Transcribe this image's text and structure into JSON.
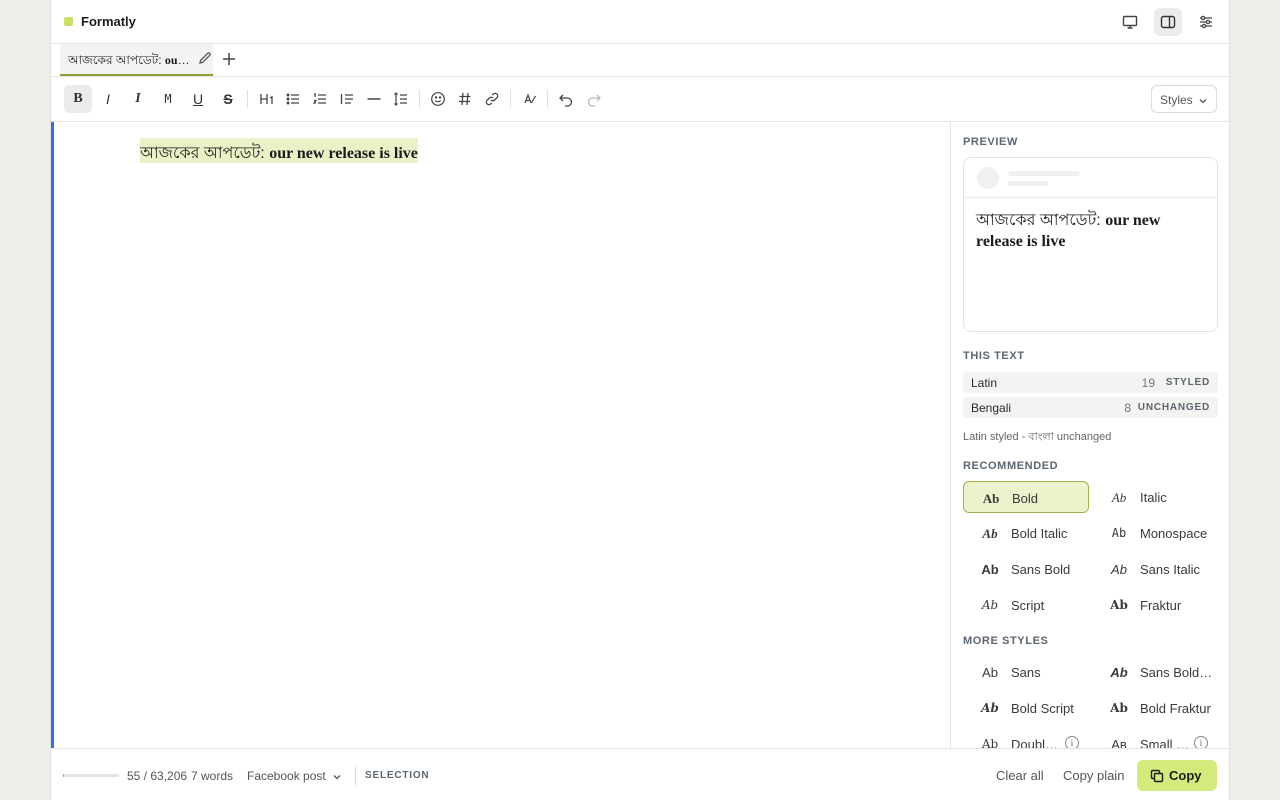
{
  "app": {
    "title": "Formatly",
    "brand_color": "#c8e06a",
    "accent_color": "#3b6fd6"
  },
  "topbar": {
    "icons": [
      "monitor-icon",
      "split-panel-icon",
      "sliders-icon"
    ],
    "active_icon": "split-panel-icon"
  },
  "tab": {
    "label_plain": "আজকের আপডেট: ",
    "label_styled": "our new release is live",
    "edit_icon": "pencil-icon",
    "add_icon": "plus-icon"
  },
  "toolbar": {
    "buttons": [
      "bold",
      "italic",
      "italic-serif",
      "monospace",
      "underline",
      "strikethrough",
      "heading",
      "bulleted-list",
      "numbered-list",
      "quote",
      "divider",
      "line-spacing",
      "emoji",
      "hashtag",
      "link",
      "clear-format",
      "undo",
      "redo"
    ],
    "active": "bold",
    "styles_label": "Styles"
  },
  "editor": {
    "text_plain": "আজকের আপডেট: ",
    "text_styled": "our new release is live"
  },
  "sidebar": {
    "preview_label": "PREVIEW",
    "preview_text_plain": "আজকের আপডেট: ",
    "preview_text_styled": "our new release is live",
    "this_text_label": "THIS TEXT",
    "stats": [
      {
        "lang": "Latin",
        "count": "19",
        "tag": "STYLED"
      },
      {
        "lang": "Bengali",
        "count": "8",
        "tag": "UNCHANGED"
      }
    ],
    "note": "Latin styled - বাংলা unchanged",
    "recommended_label": "RECOMMENDED",
    "recommended": [
      {
        "sample": "Ab",
        "name": "Bold",
        "selected": true
      },
      {
        "sample": "Ab",
        "name": "Italic"
      },
      {
        "sample": "Ab",
        "name": "Bold Italic"
      },
      {
        "sample": "Ab",
        "name": "Monospace"
      },
      {
        "sample": "Ab",
        "name": "Sans Bold"
      },
      {
        "sample": "Ab",
        "name": "Sans Italic"
      },
      {
        "sample": "Ab",
        "name": "Script"
      },
      {
        "sample": "Ab",
        "name": "Fraktur"
      }
    ],
    "more_label": "MORE STYLES",
    "more": [
      {
        "sample": "Ab",
        "name": "Sans"
      },
      {
        "sample": "Ab",
        "name": "Sans Bold…"
      },
      {
        "sample": "Ab",
        "name": "Bold Script"
      },
      {
        "sample": "Ab",
        "name": "Bold Fraktur"
      },
      {
        "sample": "Ab",
        "name": "Doubl…"
      },
      {
        "sample": "Aʙ",
        "name": "Small …"
      }
    ]
  },
  "footer": {
    "progress_fraction": 0.001,
    "char_count": "55 / 63,206",
    "word_count": "7 words",
    "platform": "Facebook post",
    "selection_label": "SELECTION",
    "clear_all": "Clear all",
    "copy_plain": "Copy plain",
    "copy": "Copy"
  }
}
